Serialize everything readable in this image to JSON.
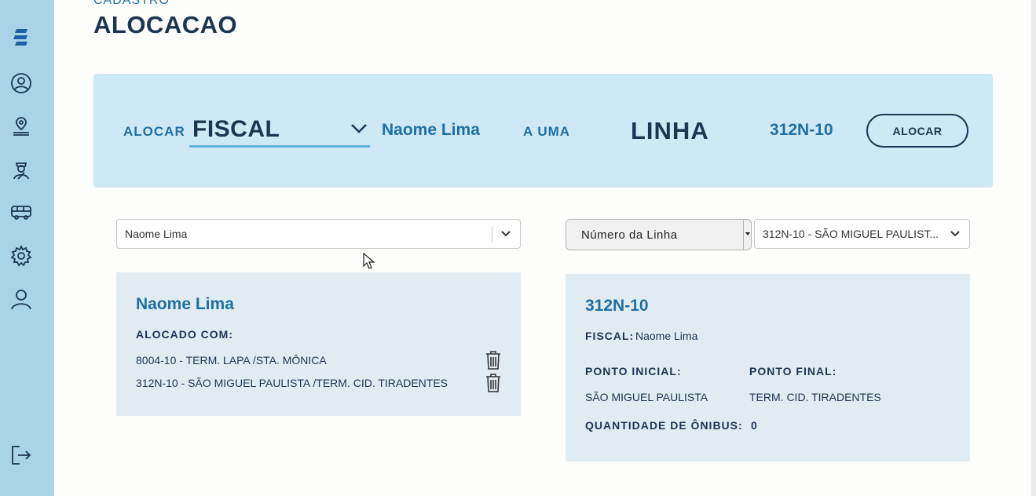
{
  "sidebar": {
    "items": [
      {
        "icon": "logo-icon"
      },
      {
        "icon": "user-icon"
      },
      {
        "icon": "location-pin-icon"
      },
      {
        "icon": "inspector-icon"
      },
      {
        "icon": "bus-icon"
      },
      {
        "icon": "gear-icon"
      },
      {
        "icon": "person-icon"
      },
      {
        "icon": "logout-icon"
      }
    ]
  },
  "header": {
    "breadcrumb": "CADASTRO",
    "title": "ALOCACAO"
  },
  "hero": {
    "alocar_label": "ALOCAR",
    "type_value": "FISCAL",
    "person_name": "Naome Lima",
    "a_uma_label": "A UMA",
    "linha_label": "LINHA",
    "line_code": "312N-10",
    "alocar_button": "ALOCAR"
  },
  "left_panel": {
    "select_value": "Naome Lima",
    "card": {
      "name": "Naome Lima",
      "allocated_label": "ALOCADO COM:",
      "allocations": [
        "8004-10 - TERM. LAPA /STA. MÔNICA",
        "312N-10 - SÃO MIGUEL PAULISTA /TERM. CID. TIRADENTES"
      ]
    }
  },
  "right_panel": {
    "filter_value": "Número da Linha",
    "line_select_value": "312N-10 - SÃO MIGUEL PAULIST...",
    "card": {
      "code": "312N-10",
      "fiscal_label": "FISCAL:",
      "fiscal_value": "Naome Lima",
      "start_label": "PONTO INICIAL:",
      "start_value": "SÃO MIGUEL PAULISTA",
      "end_label": "PONTO FINAL:",
      "end_value": "TERM. CID. TIRADENTES",
      "qty_label": "QUANTIDADE DE ÔNIBUS:",
      "qty_value": "0"
    }
  },
  "colors": {
    "sidebar": "#a9d4e8",
    "hero_bg": "#cfe8f5",
    "card_bg": "#e1ecf2",
    "accent": "#1e6fa3",
    "dark": "#1c3553"
  }
}
